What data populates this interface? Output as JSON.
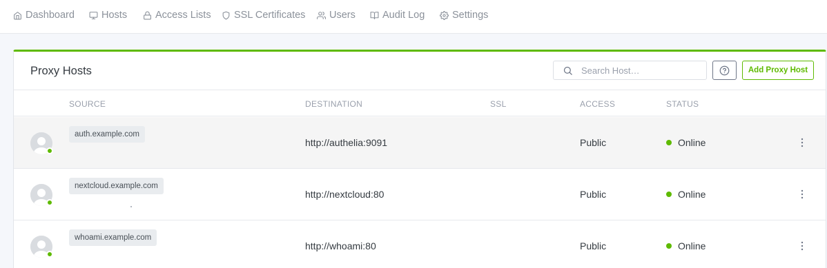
{
  "nav": {
    "items": [
      {
        "label": "Dashboard",
        "icon": "home-icon"
      },
      {
        "label": "Hosts",
        "icon": "monitor-icon"
      },
      {
        "label": "Access Lists",
        "icon": "lock-icon"
      },
      {
        "label": "SSL Certificates",
        "icon": "shield-icon"
      },
      {
        "label": "Users",
        "icon": "users-icon"
      },
      {
        "label": "Audit Log",
        "icon": "book-icon"
      },
      {
        "label": "Settings",
        "icon": "gear-icon"
      }
    ]
  },
  "card": {
    "title": "Proxy Hosts",
    "search_placeholder": "Search Host…",
    "add_button": "Add Proxy Host",
    "accent_color": "#5eba00"
  },
  "table": {
    "columns": [
      "SOURCE",
      "DESTINATION",
      "SSL",
      "ACCESS",
      "STATUS"
    ],
    "rows": [
      {
        "source": "auth.example.com",
        "destination": "http://authelia:9091",
        "ssl": "",
        "access": "Public",
        "status": "Online"
      },
      {
        "source": "nextcloud.example.com",
        "destination": "http://nextcloud:80",
        "ssl": "",
        "access": "Public",
        "status": "Online"
      },
      {
        "source": "whoami.example.com",
        "destination": "http://whoami:80",
        "ssl": "",
        "access": "Public",
        "status": "Online"
      }
    ]
  }
}
